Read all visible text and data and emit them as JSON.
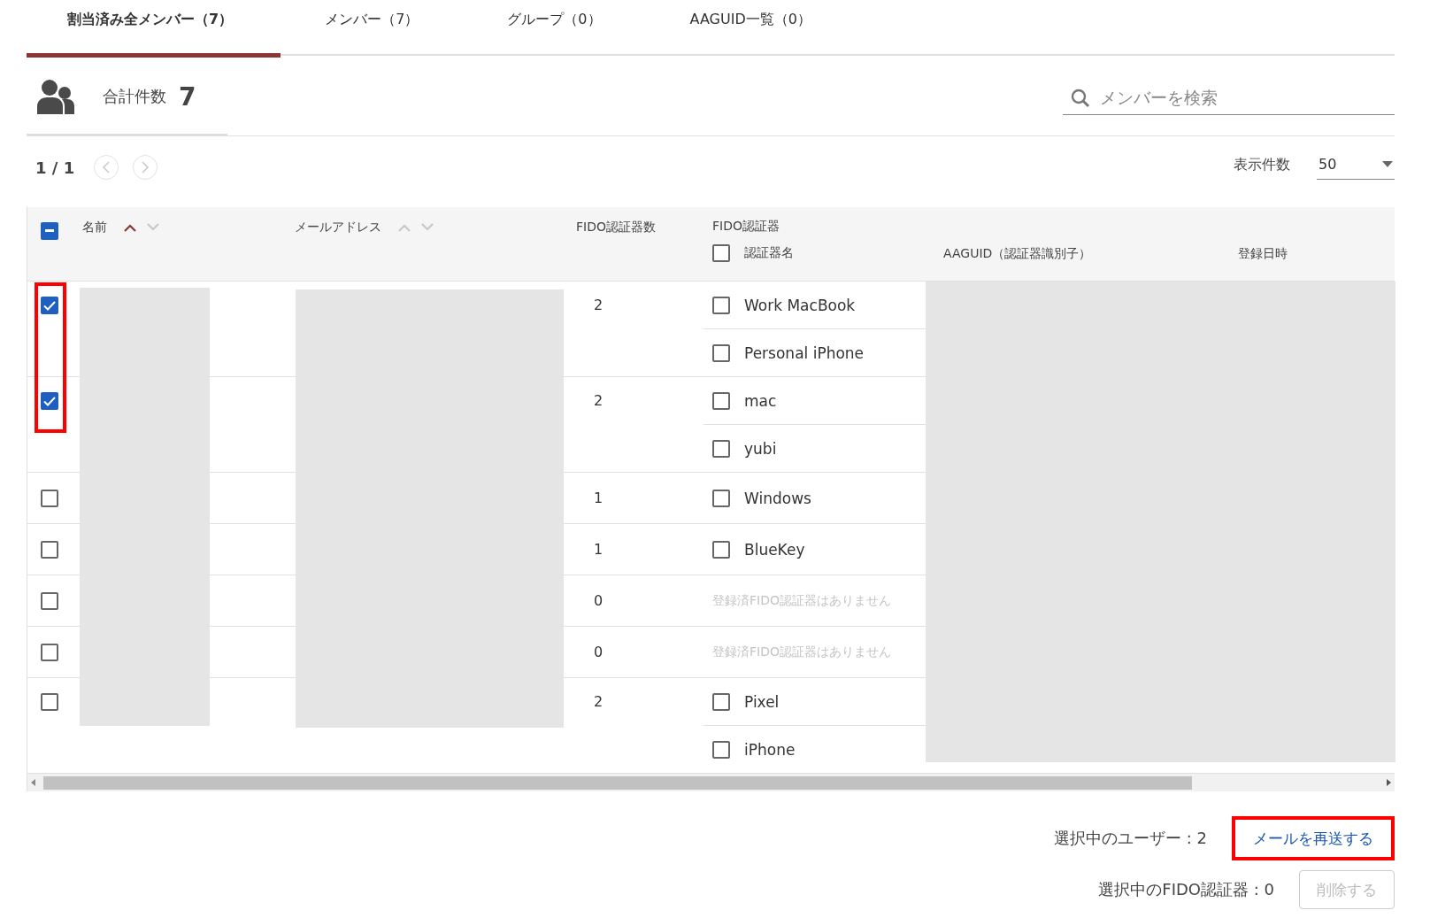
{
  "tabs": [
    {
      "label": "割当済み全メンバー（7）",
      "selected": true
    },
    {
      "label": "メンバー（7）",
      "selected": false
    },
    {
      "label": "グループ（0）",
      "selected": false
    },
    {
      "label": "AAGUID一覧（0）",
      "selected": false
    }
  ],
  "summary": {
    "label": "合計件数",
    "count": "7"
  },
  "search": {
    "placeholder": "メンバーを検索"
  },
  "pager": {
    "text": "1 / 1",
    "prev_disabled": true,
    "next_disabled": true
  },
  "page_size": {
    "label": "表示件数",
    "value": "50"
  },
  "table": {
    "select_all_indeterminate": true,
    "columns": [
      {
        "label": "名前",
        "sort_ascending": true,
        "sort_descending": false
      },
      {
        "label": "メールアドレス",
        "sort_ascending": false,
        "sort_descending": false
      },
      {
        "label": "FIDO認証器数"
      }
    ],
    "fido_group": {
      "label": "FIDO認証器",
      "select_all_checked": false,
      "columns": [
        "認証器名",
        "AAGUID（認証器識別子）",
        "登録日時"
      ]
    },
    "rows": [
      {
        "checked": true,
        "highlighted": true,
        "count": "2",
        "authenticators": [
          {
            "name": "Work MacBook",
            "checked": false
          },
          {
            "name": "Personal iPhone",
            "checked": false
          }
        ]
      },
      {
        "checked": true,
        "highlighted": true,
        "count": "2",
        "authenticators": [
          {
            "name": "mac",
            "checked": false
          },
          {
            "name": "yubi",
            "checked": false
          }
        ]
      },
      {
        "checked": false,
        "highlighted": false,
        "count": "1",
        "authenticators": [
          {
            "name": "Windows",
            "checked": false
          }
        ]
      },
      {
        "checked": false,
        "highlighted": false,
        "count": "1",
        "authenticators": [
          {
            "name": "BlueKey",
            "checked": false
          }
        ]
      },
      {
        "checked": false,
        "highlighted": false,
        "count": "0",
        "empty_text": "登録済FIDO認証器はありません"
      },
      {
        "checked": false,
        "highlighted": false,
        "count": "0",
        "empty_text": "登録済FIDO認証器はありません"
      },
      {
        "checked": false,
        "highlighted": false,
        "count": "2",
        "authenticators": [
          {
            "name": "Pixel",
            "checked": false
          },
          {
            "name": "iPhone",
            "checked": false
          }
        ]
      }
    ]
  },
  "footer": {
    "selected_users": "選択中のユーザー : 2",
    "resend": {
      "label": "メールを再送する",
      "highlighted": true,
      "disabled": false
    },
    "selected_authenticators": "選択中のFIDO認証器 : 0",
    "delete": {
      "label": "削除する",
      "disabled": true
    }
  }
}
